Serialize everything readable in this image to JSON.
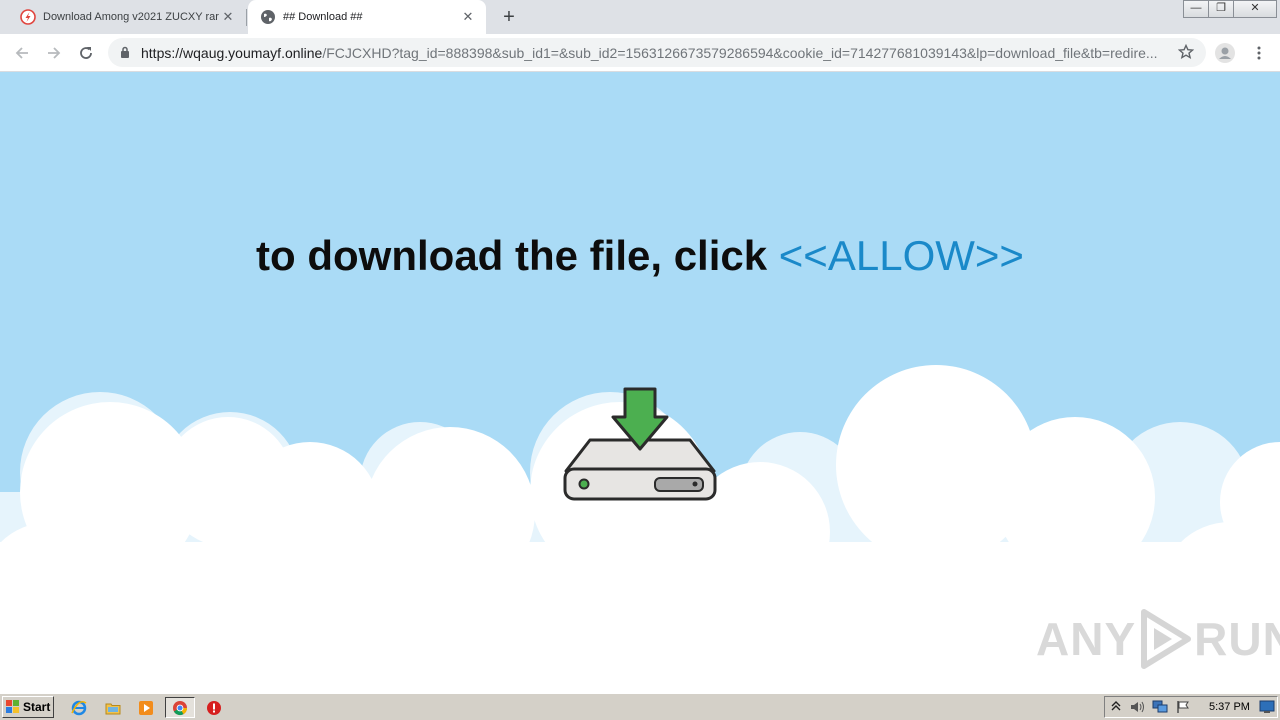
{
  "browser": {
    "tabs": [
      {
        "title": "Download Among v2021 ZUCXY rar",
        "active": false,
        "close": "✕"
      },
      {
        "title": "## Download ##",
        "active": true,
        "close": "✕"
      }
    ],
    "new_tab": "+",
    "window_controls": {
      "minimize": "—",
      "restore": "❐",
      "close": "✕"
    },
    "url": {
      "host": "https://wqaug.youmayf.online",
      "path": "/FCJCXHD?tag_id=888398&sub_id1=&sub_id2=1563126673579286594&cookie_id=714277681039143&lp=download_file&tb=redire..."
    }
  },
  "page": {
    "headline": "to download the file, click ",
    "allow": "<<ALLOW>>",
    "colors": {
      "sky": "#aadbf6",
      "cloud": "#ffffff",
      "allow": "#1a89c9",
      "arrow": "#4caf50"
    },
    "watermark": {
      "left": "ANY",
      "right": "RUN"
    }
  },
  "taskbar": {
    "start_label": "Start",
    "icons": [
      "ie-icon",
      "explorer-icon",
      "media-player-icon",
      "chrome-icon",
      "stop-icon"
    ],
    "tray": [
      "show-hidden-icon",
      "volume-icon",
      "network-icon",
      "flag-icon",
      "desktop-icon"
    ],
    "clock": "5:37 PM"
  }
}
